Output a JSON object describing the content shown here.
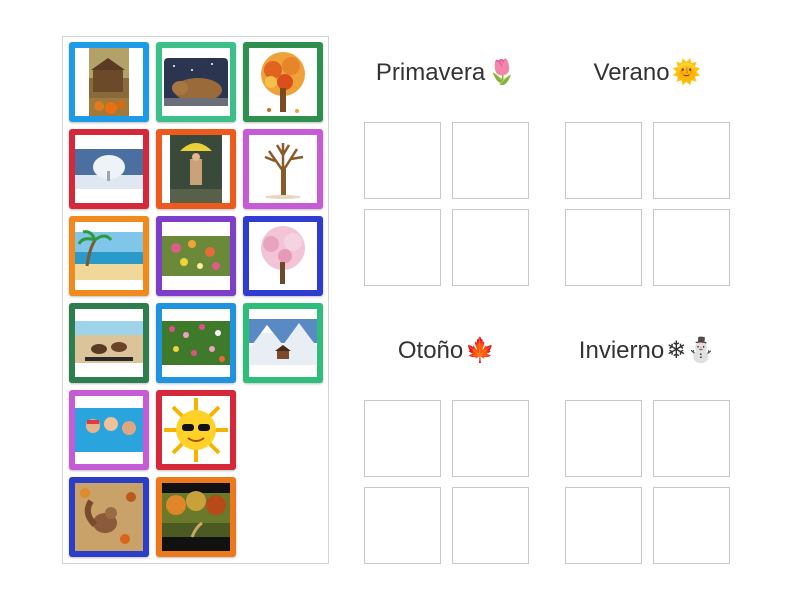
{
  "tile_bank": {
    "tiles": [
      {
        "color": "#1e9be6",
        "image": "barn-pumpkins-icon"
      },
      {
        "color": "#3dbf8a",
        "image": "sleeping-bear-icon"
      },
      {
        "color": "#2f8f4e",
        "image": "autumn-tree-icon"
      },
      {
        "color": "#d5293b",
        "image": "snowy-tree-icon"
      },
      {
        "color": "#ec5a1d",
        "image": "rain-umbrella-icon"
      },
      {
        "color": "#c65bd6",
        "image": "bare-tree-icon"
      },
      {
        "color": "#f08a1c",
        "image": "palm-beach-icon"
      },
      {
        "color": "#7d3fc9",
        "image": "flower-bush-icon"
      },
      {
        "color": "#2f3ccf",
        "image": "blossom-tree-icon"
      },
      {
        "color": "#2e7d4f",
        "image": "beach-sandals-icon"
      },
      {
        "color": "#1f93e0",
        "image": "flower-field-icon"
      },
      {
        "color": "#2fbd7c",
        "image": "snowy-mountains-icon"
      },
      {
        "color": "#c65bd6",
        "image": "kids-pool-icon"
      },
      {
        "color": "#d5293b",
        "image": "sun-sunglasses-icon"
      },
      {
        "color": "#2a3ec8",
        "image": "squirrel-leaves-icon"
      },
      {
        "color": "#ec7a1d",
        "image": "autumn-forest-icon"
      }
    ]
  },
  "categories": [
    {
      "name": "Primavera",
      "emoji": "🌷",
      "icon": "tulip-icon"
    },
    {
      "name": "Verano",
      "emoji": "🌞",
      "icon": "sun-icon"
    },
    {
      "name": "Otoño",
      "emoji": "🍁",
      "icon": "maple-leaf-icon"
    },
    {
      "name": "Invierno",
      "emoji": "❄⛄",
      "icon": "snowflake-snowman-icon"
    }
  ]
}
